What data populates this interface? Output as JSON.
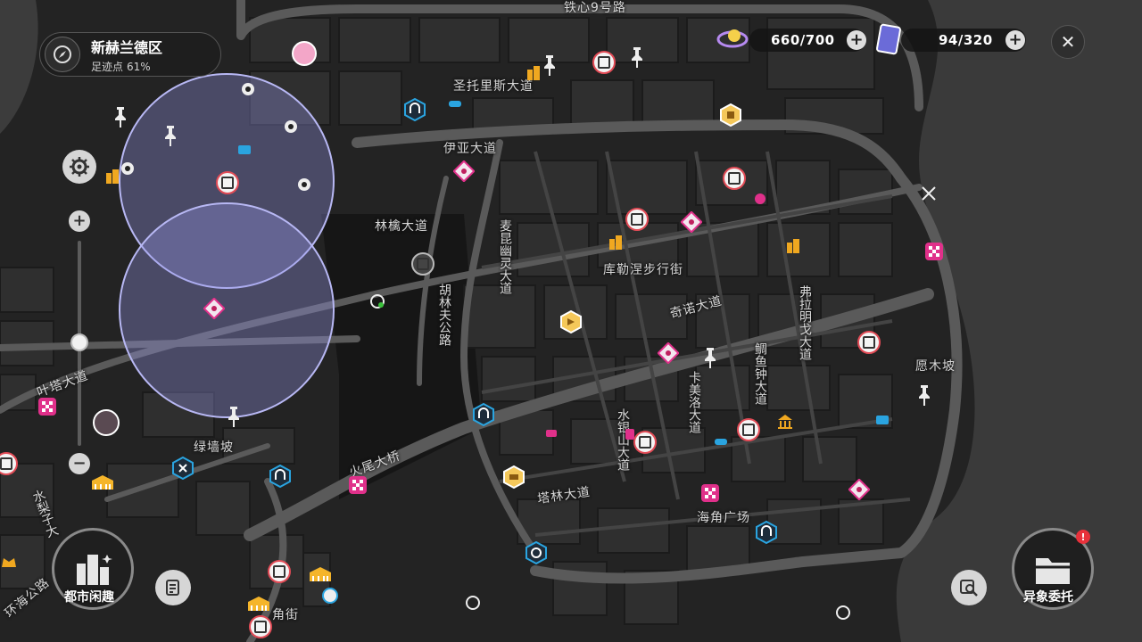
{
  "hud": {
    "district_name": "新赫兰德区",
    "footprint_label": "足迹点",
    "footprint_percent": "61%",
    "stamina_value": "660/700",
    "tickets_value": "94/320"
  },
  "buttons": {
    "city_fun_label": "都市闲趣",
    "anomaly_label": "异象委托",
    "badge_text": "!"
  },
  "roads": {
    "tiexin": "铁心9号路",
    "shengtuoli": "圣托里斯大道",
    "yiya": "伊亚大道",
    "linqin": "林檎大道",
    "kule": "库勒涅步行街",
    "qinuo": "奇诺大道",
    "yuanmu": "愿木坡",
    "luqiang": "绿墙坡",
    "talin": "塔林大道",
    "haijiao": "海角广场",
    "huoweiqiao": "火尾大桥",
    "jiaoshao": "角街",
    "fula": "弗拉明戈大道",
    "jiyu": "鲷鱼钟大道",
    "kamei": "卡美洛大道",
    "shuiyin": "水银山大道",
    "hulin": "胡林夫公路",
    "maiqi": "麦昆幽灵大道",
    "yeshu": "叶塔大道",
    "huan": "环海公路",
    "shuiyin2": "水梨子大"
  },
  "colors": {
    "accent_red": "#e24b56",
    "accent_blue": "#2aa4e0",
    "accent_gold": "#f0a820",
    "accent_pink": "#e0308a",
    "circle_fill": "rgba(150,150,230,0.35)"
  }
}
